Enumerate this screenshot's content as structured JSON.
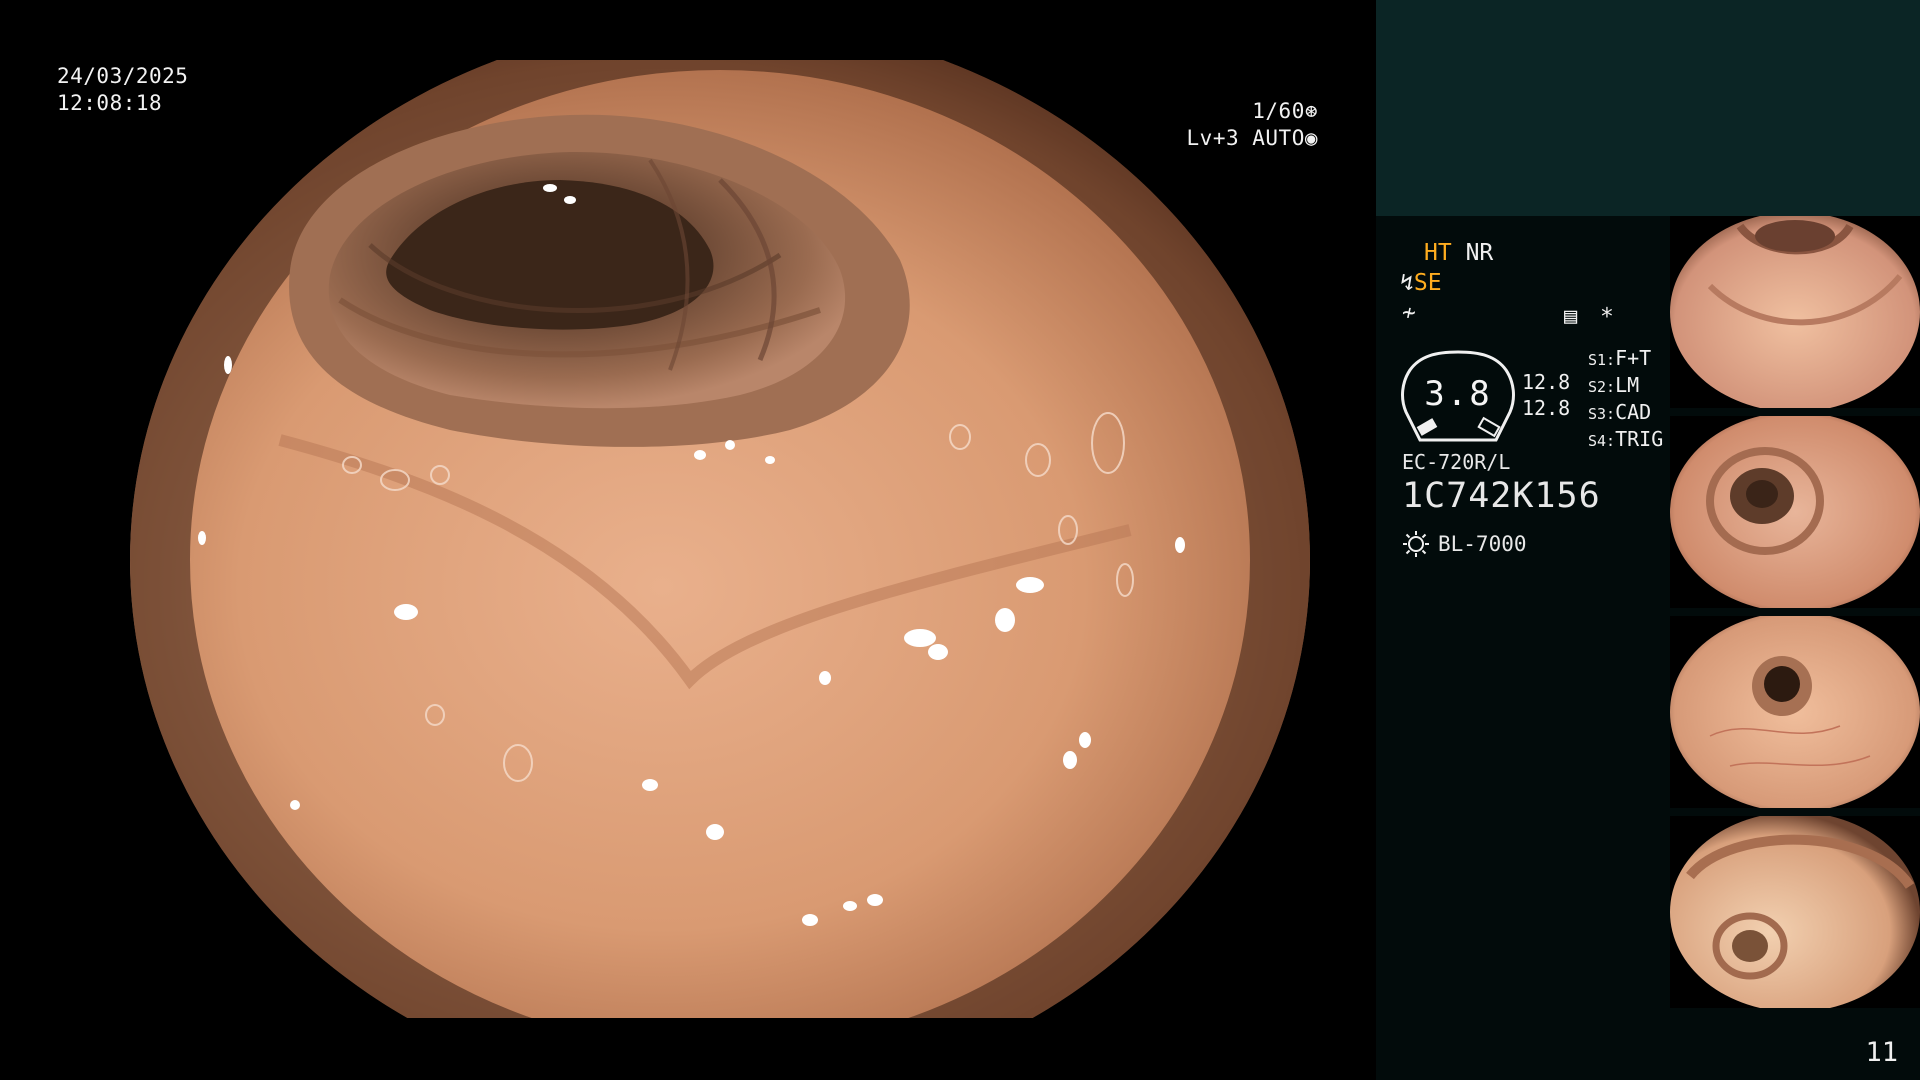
{
  "overlay": {
    "date": "24/03/2025",
    "time": "12:08:18",
    "shutter": "1/60",
    "level": "Lv+3",
    "iris": "AUTO"
  },
  "settings": {
    "ht": "HT",
    "nr": "NR",
    "se": "SE",
    "gauge_value": "3.8",
    "val1": "12.8",
    "val2": "12.8",
    "switches": [
      {
        "key": "S1:",
        "value": "F+T"
      },
      {
        "key": "S2:",
        "value": "LM"
      },
      {
        "key": "S3:",
        "value": "CAD"
      },
      {
        "key": "S4:",
        "value": "TRIG"
      }
    ],
    "scope_model": "EC-720R/L",
    "scope_serial": "1C742K156",
    "light_source": "BL-7000",
    "asterisk": "*"
  },
  "page_number": "11",
  "colors": {
    "accent_orange": "#ffad1f",
    "panel_bg": "#020b0b",
    "top_bar": "#0b2525",
    "mucosa": "#d99a72"
  },
  "icons": [
    "aperture-icon",
    "iris-icon",
    "cable-icon",
    "sharpness-icon",
    "report-icon",
    "light-source-icon"
  ]
}
